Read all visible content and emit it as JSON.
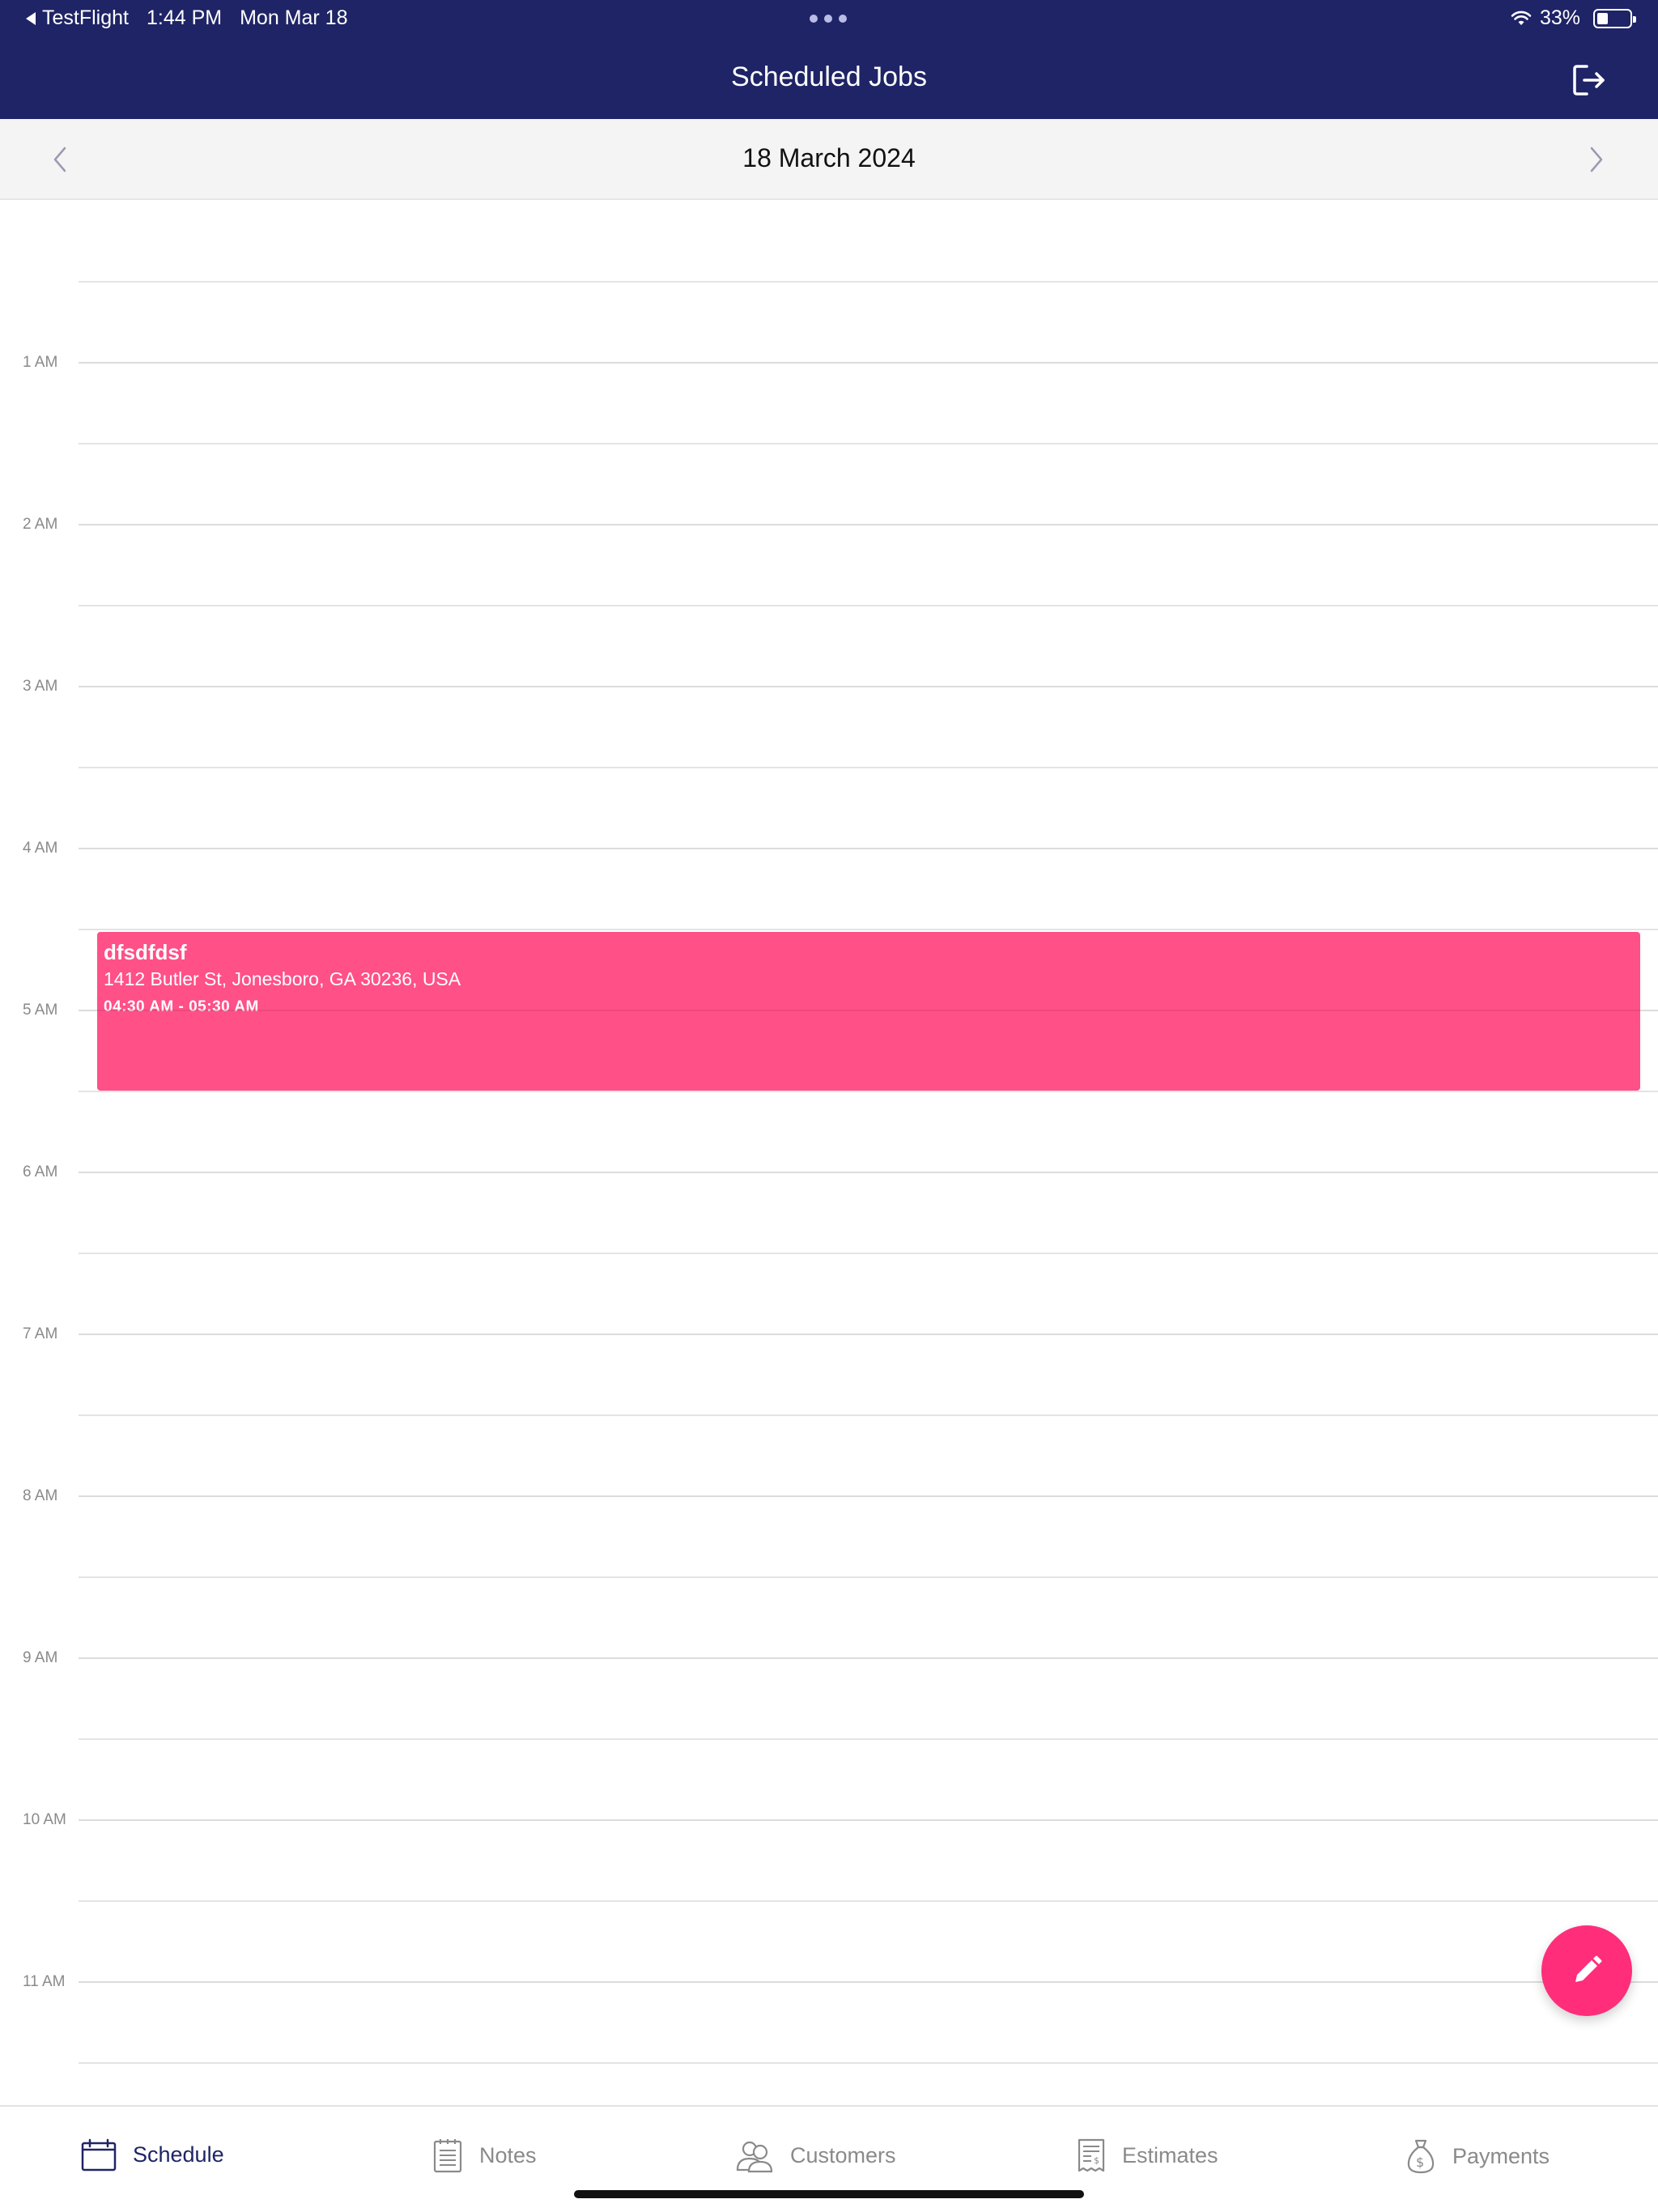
{
  "status_bar": {
    "back_app": "TestFlight",
    "time": "1:44 PM",
    "date": "Mon Mar 18",
    "battery": "33%",
    "battery_level": 0.33
  },
  "header": {
    "title": "Scheduled Jobs",
    "logout_icon": "logout-icon"
  },
  "date_nav": {
    "current_date": "18 March 2024",
    "prev_icon": "chevron-left-icon",
    "next_icon": "chevron-right-icon"
  },
  "timeline": {
    "hours": [
      "1 AM",
      "2 AM",
      "3 AM",
      "4 AM",
      "5 AM",
      "6 AM",
      "7 AM",
      "8 AM",
      "9 AM",
      "10 AM",
      "11 AM"
    ]
  },
  "event": {
    "title": "dfsdfdsf",
    "address": "1412 Butler St, Jonesboro, GA 30236, USA",
    "time_range": "04:30 AM - 05:30 AM",
    "color": "#ff5088"
  },
  "fab": {
    "icon": "pencil-icon",
    "color": "#ff2d7a"
  },
  "tabs": [
    {
      "label": "Schedule",
      "icon": "calendar-icon",
      "active": true
    },
    {
      "label": "Notes",
      "icon": "notepad-icon",
      "active": false
    },
    {
      "label": "Customers",
      "icon": "users-icon",
      "active": false
    },
    {
      "label": "Estimates",
      "icon": "invoice-icon",
      "active": false
    },
    {
      "label": "Payments",
      "icon": "money-bag-icon",
      "active": false
    }
  ],
  "colors": {
    "navy": "#1f2466",
    "accent": "#ff2d7a"
  }
}
